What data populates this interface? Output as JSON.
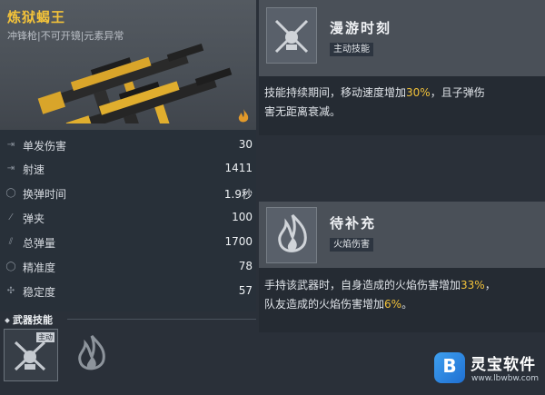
{
  "weapon": {
    "name": "炼狱蝎王",
    "subtitle": "冲锋枪|不可开镜|元素异常"
  },
  "stats": [
    {
      "icon": "damage-icon",
      "label": "单发伤害",
      "value": "30"
    },
    {
      "icon": "fire-rate-icon",
      "label": "射速",
      "value": "1411"
    },
    {
      "icon": "reload-time-icon",
      "label": "换弹时间",
      "value": "1.9秒"
    },
    {
      "icon": "magazine-icon",
      "label": "弹夹",
      "value": "100"
    },
    {
      "icon": "total-ammo-icon",
      "label": "总弹量",
      "value": "1700"
    },
    {
      "icon": "accuracy-icon",
      "label": "精准度",
      "value": "78"
    },
    {
      "icon": "stability-icon",
      "label": "稳定度",
      "value": "57"
    }
  ],
  "skills_section": {
    "header": "武器技能",
    "active_badge": "主动"
  },
  "skill_active": {
    "name": "漫游时刻",
    "tag": "主动技能",
    "desc_line1_a": "技能持续期间，移动速度增加",
    "desc_line1_hl": "30%",
    "desc_line1_b": "，且子弹伤",
    "desc_line2": "害无距离衰减。"
  },
  "skill_passive": {
    "name": "待补充",
    "tag": "火焰伤害",
    "desc_line1_a": "手持该武器时，自身造成的火焰伤害增加",
    "desc_line1_hl": "33%",
    "desc_line1_b": "，",
    "desc_line2_a": "队友造成的火焰伤害增加",
    "desc_line2_hl": "6%",
    "desc_line2_b": "。"
  },
  "watermark": {
    "title": "灵宝软件",
    "url": "www.lbwbw.com"
  },
  "colors": {
    "highlight": "#f2c23a",
    "panel_dark": "#252b33",
    "panel_light": "#4a5058"
  }
}
